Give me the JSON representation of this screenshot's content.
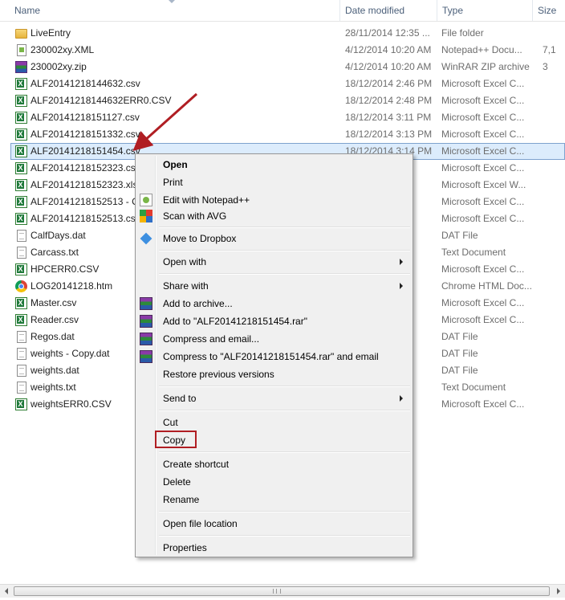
{
  "columns": {
    "name": "Name",
    "date_modified": "Date modified",
    "type": "Type",
    "size": "Size"
  },
  "files": [
    {
      "name": "LiveEntry",
      "date": "28/11/2014 12:35 ...",
      "type": "File folder",
      "size": "",
      "icon": "folder-icon"
    },
    {
      "name": "230002xy.XML",
      "date": "4/12/2014 10:20 AM",
      "type": "Notepad++ Docu...",
      "size": "7,1",
      "icon": "notepad-file-icon"
    },
    {
      "name": "230002xy.zip",
      "date": "4/12/2014 10:20 AM",
      "type": "WinRAR ZIP archive",
      "size": "3",
      "icon": "winrar-zip-icon"
    },
    {
      "name": "ALF20141218144632.csv",
      "date": "18/12/2014 2:46 PM",
      "type": "Microsoft Excel C...",
      "size": "",
      "icon": "excel-file-icon"
    },
    {
      "name": "ALF20141218144632ERR0.CSV",
      "date": "18/12/2014 2:48 PM",
      "type": "Microsoft Excel C...",
      "size": "",
      "icon": "excel-file-icon"
    },
    {
      "name": "ALF20141218151127.csv",
      "date": "18/12/2014 3:11 PM",
      "type": "Microsoft Excel C...",
      "size": "",
      "icon": "excel-file-icon"
    },
    {
      "name": "ALF20141218151332.csv",
      "date": "18/12/2014 3:13 PM",
      "type": "Microsoft Excel C...",
      "size": "",
      "icon": "excel-file-icon"
    },
    {
      "name": "ALF20141218151454.csv",
      "date": "18/12/2014 3:14 PM",
      "type": "Microsoft Excel C...",
      "size": "",
      "icon": "excel-file-icon",
      "selected": true
    },
    {
      "name": "ALF20141218152323.csv",
      "date": "",
      "type": "Microsoft Excel C...",
      "size": "",
      "icon": "excel-file-icon"
    },
    {
      "name": "ALF20141218152323.xlsx",
      "date": "",
      "type": "Microsoft Excel W...",
      "size": "",
      "icon": "excel-file-icon"
    },
    {
      "name": "ALF20141218152513 - Co",
      "date": "",
      "type": "Microsoft Excel C...",
      "size": "",
      "icon": "excel-file-icon"
    },
    {
      "name": "ALF20141218152513.csv",
      "date": "",
      "type": "Microsoft Excel C...",
      "size": "",
      "icon": "excel-file-icon"
    },
    {
      "name": "CalfDays.dat",
      "date": "M",
      "type": "DAT File",
      "size": "",
      "icon": "document-icon"
    },
    {
      "name": "Carcass.txt",
      "date": "1",
      "type": "Text Document",
      "size": "",
      "icon": "document-icon"
    },
    {
      "name": "HPCERR0.CSV",
      "date": "",
      "type": "Microsoft Excel C...",
      "size": "",
      "icon": "excel-file-icon"
    },
    {
      "name": "LOG20141218.htm",
      "date": "5",
      "type": "Chrome HTML Doc...",
      "size": "",
      "icon": "chrome-icon"
    },
    {
      "name": "Master.csv",
      "date": "",
      "type": "Microsoft Excel C...",
      "size": "",
      "icon": "excel-file-icon"
    },
    {
      "name": "Reader.csv",
      "date": "9",
      "type": "Microsoft Excel C...",
      "size": "",
      "icon": "excel-file-icon"
    },
    {
      "name": "Regos.dat",
      "date": "",
      "type": "DAT File",
      "size": "",
      "icon": "document-icon"
    },
    {
      "name": "weights - Copy.dat",
      "date": "",
      "type": "DAT File",
      "size": "",
      "icon": "document-icon"
    },
    {
      "name": "weights.dat",
      "date": "",
      "type": "DAT File",
      "size": "",
      "icon": "document-icon"
    },
    {
      "name": "weights.txt",
      "date": "",
      "type": "Text Document",
      "size": "",
      "icon": "document-icon"
    },
    {
      "name": "weightsERR0.CSV",
      "date": "",
      "type": "Microsoft Excel C...",
      "size": "",
      "icon": "excel-file-icon"
    }
  ],
  "context_menu": {
    "open": "Open",
    "print": "Print",
    "edit_notepad": "Edit with Notepad++",
    "scan_avg": "Scan with AVG",
    "move_dropbox": "Move to Dropbox",
    "open_with": "Open with",
    "share_with": "Share with",
    "add_archive": "Add to archive...",
    "add_rar": "Add to \"ALF20141218151454.rar\"",
    "compress_email": "Compress and email...",
    "compress_rar_email": "Compress to \"ALF20141218151454.rar\" and email",
    "restore_versions": "Restore previous versions",
    "send_to": "Send to",
    "cut": "Cut",
    "copy": "Copy",
    "create_shortcut": "Create shortcut",
    "delete": "Delete",
    "rename": "Rename",
    "open_location": "Open file location",
    "properties": "Properties"
  },
  "colors": {
    "selection_bg": "#dcecfc",
    "selection_border": "#7da2ce",
    "annotation_red": "#b01e23"
  }
}
